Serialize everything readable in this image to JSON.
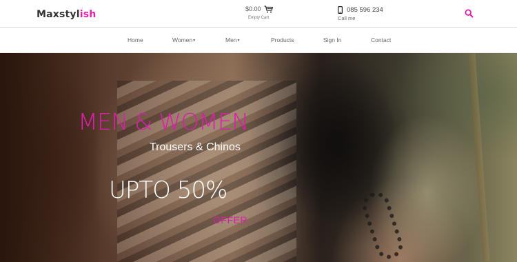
{
  "brand": {
    "logo_part1": "Maxstyl",
    "logo_part2": "ish",
    "accent_color": "#e01cae"
  },
  "header": {
    "cart": {
      "amount": "$0.00",
      "label": "Empty Cart",
      "icon": "cart-icon"
    },
    "contact": {
      "phone": "085 596 234",
      "label": "Call me",
      "icon": "phone-icon"
    },
    "search": {
      "icon": "search-icon"
    }
  },
  "nav": {
    "items": [
      {
        "label": "Home"
      },
      {
        "label": "Women",
        "dropdown": true
      },
      {
        "label": "Men",
        "dropdown": true
      },
      {
        "label": "Products"
      },
      {
        "label": "Sign In"
      },
      {
        "label": "Contact"
      }
    ]
  },
  "hero": {
    "title": "MEN & WOMEN",
    "subtitle": "Trousers & Chinos",
    "offer": "UPTO 50%",
    "offer_label": "OFFER"
  }
}
